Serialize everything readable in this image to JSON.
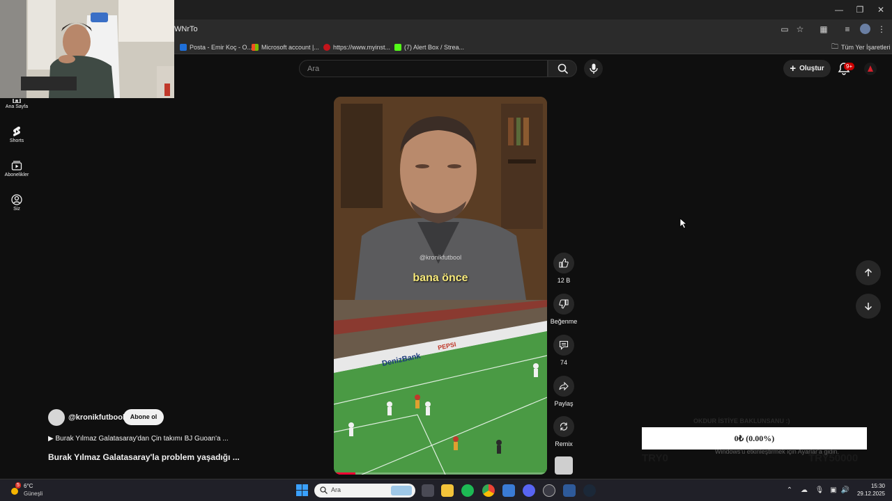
{
  "browser": {
    "url_fragment": "WNrTo",
    "bookmarks": [
      {
        "label": "Posta - Emir Koç - O...",
        "color": "#1e6fd9"
      },
      {
        "label": "Microsoft account |...",
        "color": "#f25022"
      },
      {
        "label": "https://www.myinst...",
        "color": "#c4141b"
      },
      {
        "label": "(7) Alert Box / Strea...",
        "color": "#53fc18"
      }
    ],
    "all_bookmarks_label": "Tüm Yer İşaretleri"
  },
  "youtube": {
    "search_placeholder": "Ara",
    "create_label": "Oluştur",
    "notification_count": "9+",
    "sidebar": [
      {
        "label": "Ana Sayfa",
        "icon": "home-icon"
      },
      {
        "label": "Shorts",
        "icon": "shorts-icon"
      },
      {
        "label": "Abonelikler",
        "icon": "subscriptions-icon"
      },
      {
        "label": "Siz",
        "icon": "user-icon"
      }
    ]
  },
  "short": {
    "watermark": "@kronikfutbool",
    "caption": "bana önce",
    "progress": 0.1,
    "actions": {
      "like_count": "12 B",
      "dislike_label": "Beğenme",
      "comment_count": "74",
      "share_label": "Paylaş",
      "remix_label": "Remix"
    },
    "channel_name": "@kronikfutbool",
    "subscribe_label": "Abone ol",
    "playlist_line": "▶ Burak Yılmaz Galatasaray'dan Çin takımı BJ Guoan'a ...",
    "title": "Burak Yılmaz Galatasaray'la problem yaşadığı ..."
  },
  "donation_overlay": {
    "ghost_title": "OKDUR İSTİYE BAKLUNSANU :)",
    "amount": "0₺ (0.00%)",
    "min": "TRY0",
    "max": "TRY50000"
  },
  "windows": {
    "activation_notice": "Windows'u etkinleştirmek için Ayarlar'a gidin.",
    "weather_temp": "6°C",
    "weather_desc": "Güneşli",
    "weather_badge": "5",
    "taskbar_search": "Ara",
    "time": "15:30",
    "date": "29.12.2025"
  }
}
